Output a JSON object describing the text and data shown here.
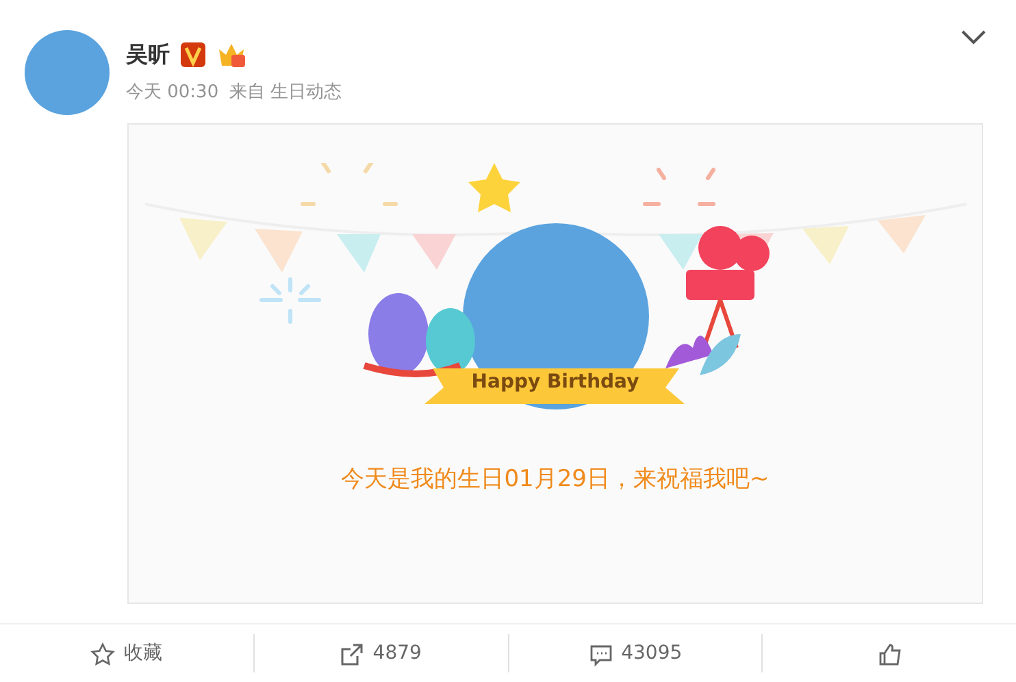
{
  "post": {
    "author": "吴昕",
    "time": "今天 00:30",
    "source_prefix": "来自",
    "source": "生日动态"
  },
  "card": {
    "banner": "Happy Birthday",
    "message": "今天是我的生日01月29日，来祝福我吧~"
  },
  "actions": [
    {
      "kind": "favorite",
      "label": "收藏"
    },
    {
      "kind": "repost",
      "label": "4879"
    },
    {
      "kind": "comment",
      "label": "43095"
    },
    {
      "kind": "like"
    }
  ]
}
